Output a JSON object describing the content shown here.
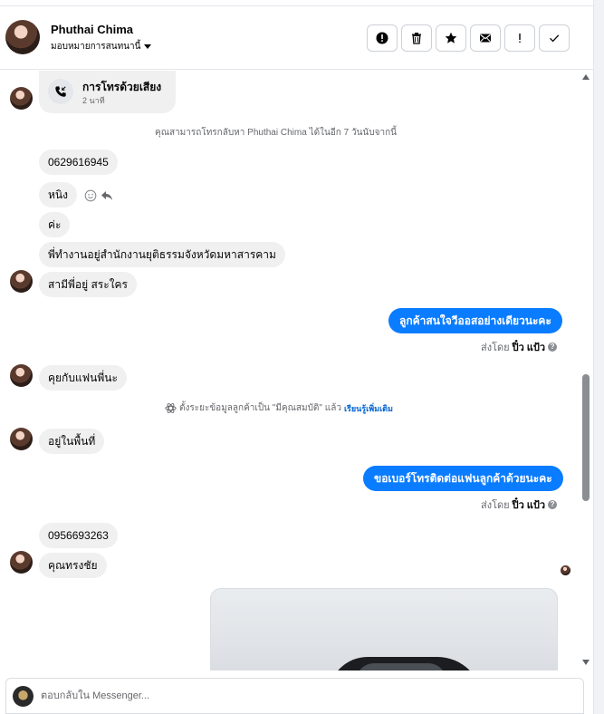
{
  "header": {
    "contact_name": "Phuthai Chima",
    "assign_label": "มอบหมายการสนทนานี้",
    "actions": [
      {
        "name": "report-button",
        "icon": "alert-icon"
      },
      {
        "name": "delete-button",
        "icon": "trash-icon"
      },
      {
        "name": "star-button",
        "icon": "star-icon"
      },
      {
        "name": "mark-unread-button",
        "icon": "mail-icon"
      },
      {
        "name": "spam-button",
        "icon": "exclamation-icon"
      },
      {
        "name": "done-button",
        "icon": "check-icon"
      }
    ]
  },
  "thread": {
    "call": {
      "title": "การโทรด้วยเสียง",
      "time": "2 นาที"
    },
    "callback_note": "คุณสามารถโทรกลับหา Phuthai Chima ได้ในอีก 7 วันนับจากนี้",
    "messages": [
      {
        "text": "0629616945"
      },
      {
        "text": "หนิง"
      },
      {
        "text": "ค่ะ"
      },
      {
        "text": "พี่ทำงานอยู่สำนักงานยุติธรรมจังหวัดมหาสารคาม"
      },
      {
        "text": "สามีพี่อยู่ สระใคร"
      },
      {
        "text": "ลูกค้าสนใจวีออสอย่างเดียวนะคะ",
        "outgoing": true
      },
      {
        "text": "คุยกับแฟนพี่นะ"
      },
      {
        "text": "อยู่ในพื้นที่"
      },
      {
        "text": "ขอเบอร์โทรติดต่อแฟนลูกค้าด้วยนะคะ",
        "outgoing": true
      },
      {
        "text": "0956693263"
      },
      {
        "text": "คุณทรงชัย"
      }
    ],
    "sent_by_prefix": "ส่งโดย",
    "sent_by_name": "ปิ๋ว แป้ว",
    "help_mark": "?",
    "system_note_text": "ตั้งระยะข้อมูลลูกค้าเป็น \"มีคุณสมบัติ\" แล้ว",
    "system_note_link": "เรียนรู้เพิ่มเติม"
  },
  "composer": {
    "placeholder": "ตอบกลับใน Messenger..."
  },
  "colors": {
    "outgoing_bubble": "#0a7cff",
    "incoming_bubble": "#f0f0f0",
    "link": "#0064d1"
  }
}
